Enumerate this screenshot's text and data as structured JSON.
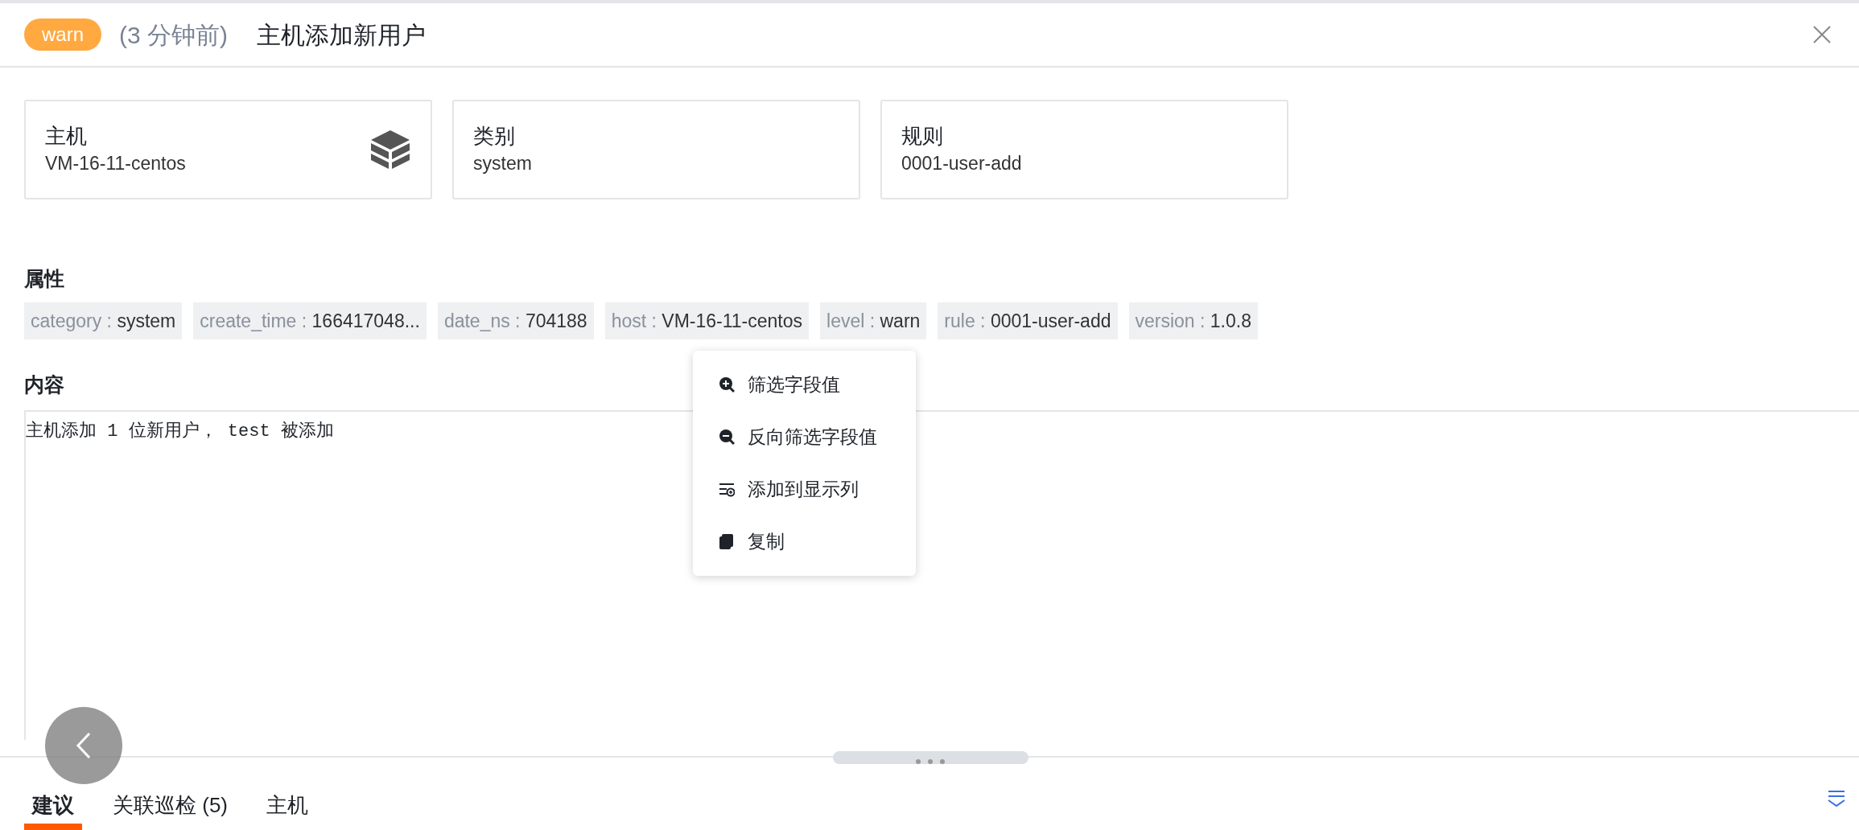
{
  "header": {
    "level_badge": "warn",
    "time_ago": "(3 分钟前)",
    "title": "主机添加新用户"
  },
  "cards": [
    {
      "label": "主机",
      "value": "VM-16-11-centos"
    },
    {
      "label": "类别",
      "value": "system"
    },
    {
      "label": "规则",
      "value": "0001-user-add"
    }
  ],
  "attributes": {
    "heading": "属性",
    "tags": [
      {
        "key": "category :",
        "value": "system"
      },
      {
        "key": "create_time :",
        "value": "166417048..."
      },
      {
        "key": "date_ns :",
        "value": "704188"
      },
      {
        "key": "host :",
        "value": "VM-16-11-centos"
      },
      {
        "key": "level :",
        "value": "warn"
      },
      {
        "key": "rule :",
        "value": "0001-user-add"
      },
      {
        "key": "version :",
        "value": "1.0.8"
      }
    ]
  },
  "context_menu": [
    {
      "label": "筛选字段值"
    },
    {
      "label": "反向筛选字段值"
    },
    {
      "label": "添加到显示列"
    },
    {
      "label": "复制"
    }
  ],
  "content": {
    "heading": "内容",
    "text": "主机添加 1 位新用户， test 被添加"
  },
  "tabs": [
    {
      "label": "建议",
      "selected": true
    },
    {
      "label": "关联巡检 (5)",
      "selected": false
    },
    {
      "label": "主机",
      "selected": false
    }
  ]
}
